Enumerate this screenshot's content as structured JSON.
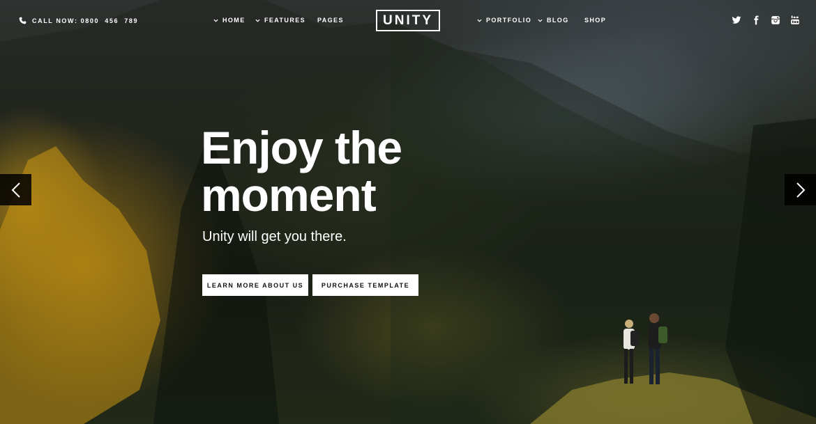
{
  "topbar": {
    "phone_icon": "phone-icon",
    "phone_text": "CALL NOW: 0800  456  789",
    "nav_left": [
      {
        "label": "HOME",
        "has_dropdown": true
      },
      {
        "label": "FEATURES",
        "has_dropdown": true
      },
      {
        "label": "PAGES",
        "has_dropdown": false
      }
    ],
    "logo": "UNITY",
    "nav_right": [
      {
        "label": "PORTFOLIO",
        "has_dropdown": true
      },
      {
        "label": "BLOG",
        "has_dropdown": true
      },
      {
        "label": "SHOP",
        "has_dropdown": false
      }
    ],
    "social_icons": [
      "twitter-icon",
      "facebook-icon",
      "instagram-icon",
      "youtube-icon"
    ]
  },
  "hero": {
    "headline_line1": "Enjoy the",
    "headline_line2": "moment",
    "subhead": "Unity will get you there.",
    "buttons": {
      "learn": "LEARN MORE ABOUT US",
      "purchase": "PURCHASE TEMPLATE"
    },
    "prev_icon": "chevron-left-icon",
    "next_icon": "chevron-right-icon"
  },
  "colors": {
    "text": "#ffffff",
    "button_bg": "#ffffff",
    "button_text": "#111111",
    "arrow_bg": "#000000"
  }
}
